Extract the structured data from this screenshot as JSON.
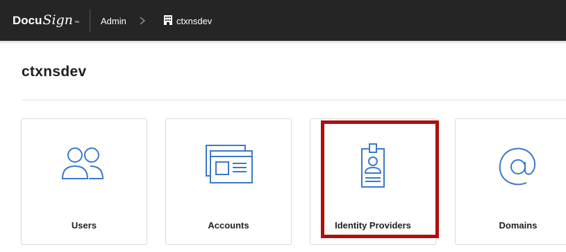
{
  "header": {
    "logo_text": "Docu",
    "logo_script": "Sign",
    "logo_tm": "™",
    "breadcrumb": {
      "admin": "Admin",
      "org": "ctxnsdev"
    }
  },
  "page": {
    "title": "ctxnsdev"
  },
  "cards": [
    {
      "label": "Users",
      "icon": "users-icon"
    },
    {
      "label": "Accounts",
      "icon": "accounts-icon"
    },
    {
      "label": "Identity Providers",
      "icon": "id-badge-icon"
    },
    {
      "label": "Domains",
      "icon": "at-sign-icon"
    }
  ],
  "colors": {
    "topbar": "#252525",
    "icon_blue": "#3b78c9",
    "highlight": "#b00d0d"
  }
}
